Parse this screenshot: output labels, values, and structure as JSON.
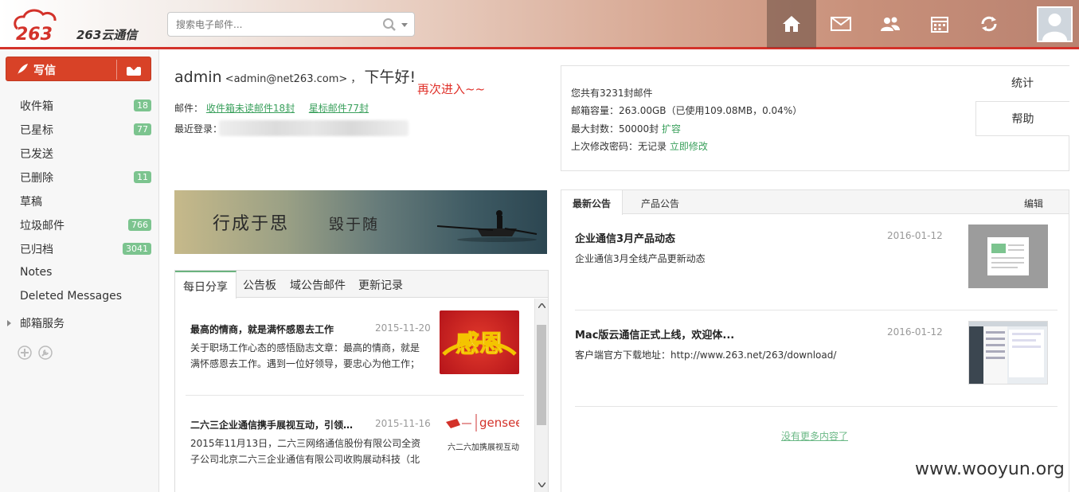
{
  "header": {
    "logo_text": "263云通信",
    "search_placeholder": "搜索电子邮件..."
  },
  "sidebar": {
    "compose_label": "写信",
    "folders": [
      {
        "label": "收件箱",
        "count": "18"
      },
      {
        "label": "已星标",
        "count": "77"
      },
      {
        "label": "已发送",
        "count": ""
      },
      {
        "label": "已删除",
        "count": "11"
      },
      {
        "label": "草稿",
        "count": ""
      },
      {
        "label": "垃圾邮件",
        "count": "766"
      },
      {
        "label": "已归档",
        "count": "3041"
      },
      {
        "label": "Notes",
        "count": ""
      },
      {
        "label": "Deleted Messages",
        "count": ""
      },
      {
        "label": "邮箱服务",
        "count": ""
      }
    ]
  },
  "greeting": {
    "name": "admin",
    "email": "<admin@net263.com>",
    "sep": "，",
    "hello": "下午好!",
    "annotation": "再次进入~~",
    "mail_label": "邮件：",
    "unread_link": "收件箱未读邮件18封",
    "star_link": "星标邮件77封",
    "last_login_label": "最近登录："
  },
  "banner": {
    "text1": "行成于思",
    "text2": "毁于随"
  },
  "share": {
    "tabs": [
      "每日分享",
      "公告板",
      "域公告邮件",
      "更新记录"
    ],
    "articles": [
      {
        "title": "最高的情商，就是满怀感恩去工作",
        "date": "2015-11-20",
        "body": "关于职场工作心态的感悟励志文章：最高的情商，就是满怀感恩去工作。遇到一位好领导，要忠心为他工作；",
        "image_text": "感恩"
      },
      {
        "title": "二六三企业通信携手展视互动，引领…",
        "date": "2015-11-16",
        "body": "2015年11月13日，二六三网络通信股份有限公司全资子公司北京二六三企业通信有限公司收购展动科技（北",
        "image_brand": "gensee",
        "image_caption": "六二六加携展视互动"
      }
    ]
  },
  "stats": {
    "total": "您共有3231封邮件",
    "capacity": "邮箱容量：263.00GB（已使用109.08MB，0.04%）",
    "max_label": "最大封数：50000封",
    "expand_link": "扩容",
    "pwd_label": "上次修改密码：无记录",
    "pwd_link": "立即修改",
    "btn_stats": "统计",
    "btn_help": "帮助"
  },
  "notice": {
    "tabs": [
      "最新公告",
      "产品公告"
    ],
    "edit": "编辑",
    "items": [
      {
        "title": "企业通信3月产品动态",
        "date": "2016-01-12",
        "body": "企业通信3月全线产品更新动态"
      },
      {
        "title": "Mac版云通信正式上线，欢迎体...",
        "date": "2016-01-12",
        "body": "客户端官方下载地址：http://www.263.net/263/download/"
      }
    ],
    "no_more": "没有更多内容了"
  },
  "watermark": "www.wooyun.org",
  "colors": {
    "brand_red": "#d84227",
    "badge_green": "#7cc48f",
    "link_green": "#3aa05c"
  }
}
